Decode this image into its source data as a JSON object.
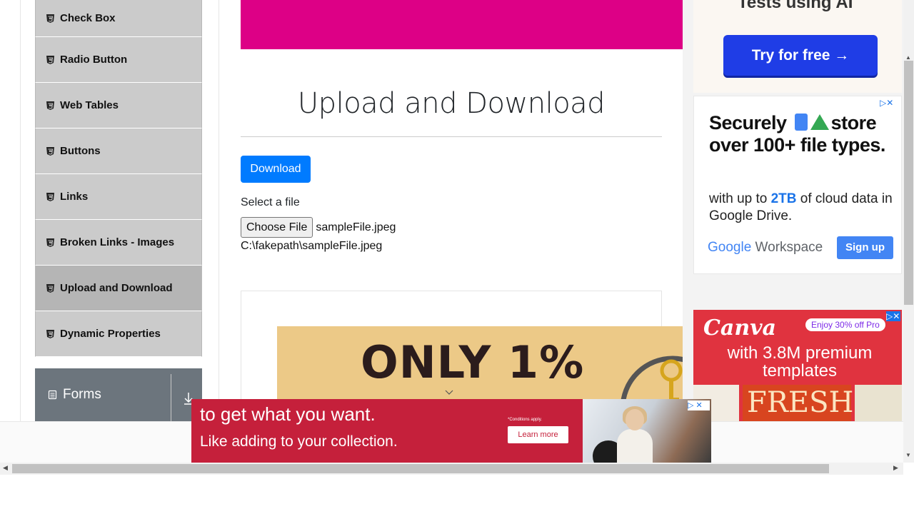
{
  "sidebar": {
    "items": [
      {
        "label": "Check Box"
      },
      {
        "label": "Radio Button"
      },
      {
        "label": "Web Tables"
      },
      {
        "label": "Buttons"
      },
      {
        "label": "Links"
      },
      {
        "label": "Broken Links - Images"
      },
      {
        "label": "Upload and Download"
      },
      {
        "label": "Dynamic Properties"
      }
    ],
    "active_item": "Upload and Download",
    "forms_group_label": "Forms"
  },
  "main": {
    "title": "Upload and Download",
    "download_button": "Download",
    "select_file_label": "Select a file",
    "choose_file_button": "Choose File",
    "chosen_file_name": "sampleFile.jpeg",
    "uploaded_path": "C:\\fakepath\\sampleFile.jpeg",
    "ad_text": "ONLY 1%"
  },
  "ads": {
    "top_right": {
      "headline": "Tests using AI",
      "cta": "Try for free →"
    },
    "workspace": {
      "headline_1": "Securely",
      "headline_2": "store",
      "headline_3": "over 100+ file types.",
      "body_pre": "with up to ",
      "body_highlight": "2TB",
      "body_post": " of cloud data in",
      "body_line2": "Google Drive.",
      "brand_google": "Google",
      "brand_workspace": " Workspace",
      "cta": "Sign up"
    },
    "canva": {
      "logo": "Canva",
      "promo": "Enjoy 30% off Pro",
      "line": "with 3.8M premium templates",
      "tile_text": "FRESH"
    },
    "bottom": {
      "line1": "to get what you want.",
      "line2": "Like adding to your collection.",
      "conditions": "*Conditions apply.",
      "cta": "Learn more"
    }
  },
  "colors": {
    "primary_button": "#007bff",
    "banner": "#dd0086",
    "sidebar_item": "#cbcbcb",
    "sidebar_active": "#b5b5b5",
    "forms_group": "#6c757d"
  }
}
